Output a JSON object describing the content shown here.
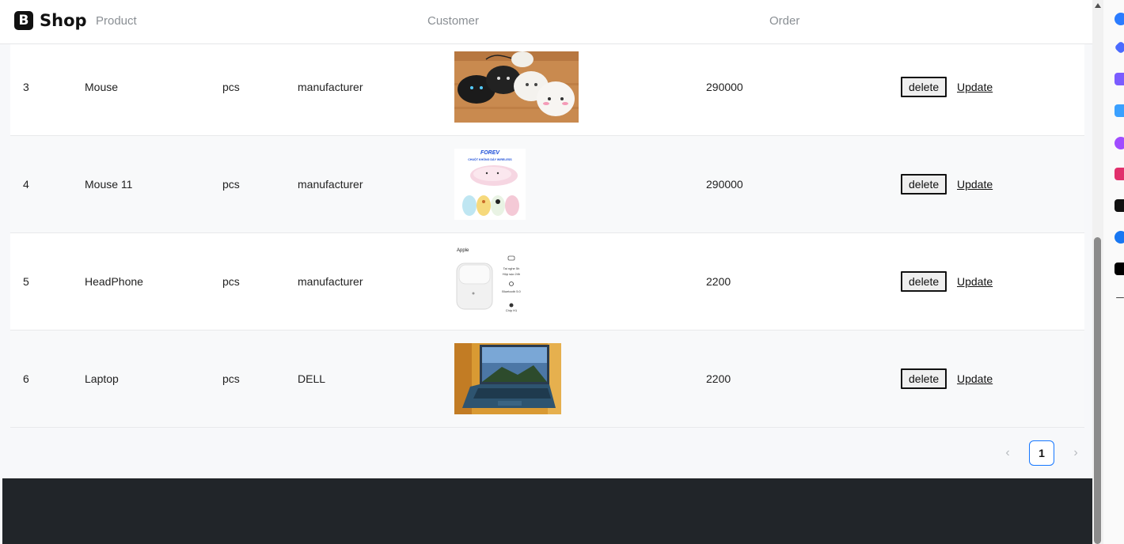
{
  "brand": {
    "logo_letter": "B",
    "name": "Shop"
  },
  "nav": {
    "items": [
      "Product",
      "Customer",
      "Order"
    ]
  },
  "table": {
    "rows": [
      {
        "id": "3",
        "name": "Mouse",
        "unit": "pcs",
        "maker": "manufacturer",
        "image": "mouse-photo",
        "price": "290000",
        "delete_label": "delete",
        "update_label": "Update"
      },
      {
        "id": "4",
        "name": "Mouse 11",
        "unit": "pcs",
        "maker": "manufacturer",
        "image": "wireless-mouse-photo",
        "price": "290000",
        "delete_label": "delete",
        "update_label": "Update"
      },
      {
        "id": "5",
        "name": "HeadPhone",
        "unit": "pcs",
        "maker": "manufacturer",
        "image": "airpods-photo",
        "price": "2200",
        "delete_label": "delete",
        "update_label": "Update"
      },
      {
        "id": "6",
        "name": "Laptop",
        "unit": "pcs",
        "maker": "DELL",
        "image": "laptop-photo",
        "price": "2200",
        "delete_label": "delete",
        "update_label": "Update"
      }
    ]
  },
  "product_image_text": {
    "wireless_brand": "FOREV",
    "wireless_caption": "CHUỘT KHÔNG DÂY WIRELESS",
    "airpods_brand": "Apple",
    "airpods_features": [
      "Tai nghe 5h",
      "Hộp sạc 24h",
      "Bluetooth 5.0",
      "Chip H1"
    ]
  },
  "pagination": {
    "prev": "‹",
    "current": "1",
    "next": "›"
  },
  "colors": {
    "pager_accent": "#1677ff",
    "footer": "#212529"
  },
  "icons": [
    "logo-icon",
    "chevron-left-icon",
    "chevron-right-icon",
    "scroll-up-icon"
  ]
}
